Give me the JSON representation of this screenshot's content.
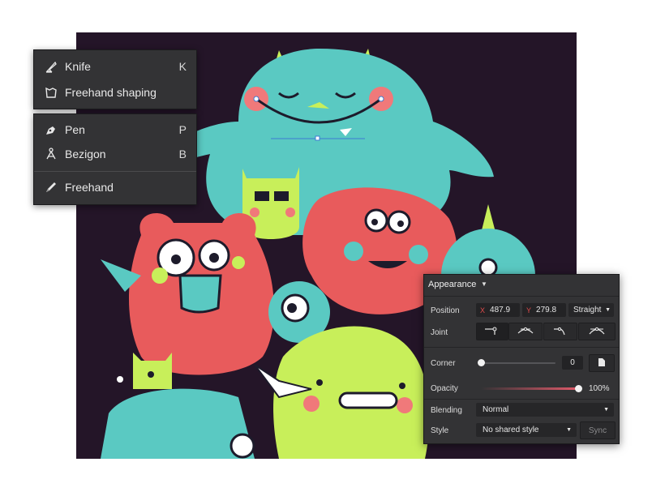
{
  "tools_top": [
    {
      "label": "Knife",
      "shortcut": "K",
      "icon": "knife-icon"
    },
    {
      "label": "Freehand shaping",
      "shortcut": "",
      "icon": "freehand-shaping-icon"
    }
  ],
  "tools_bottom": [
    {
      "label": "Pen",
      "shortcut": "P",
      "icon": "pen-icon"
    },
    {
      "label": "Bezigon",
      "shortcut": "B",
      "icon": "bezigon-icon"
    },
    {
      "label": "Freehand",
      "shortcut": "",
      "icon": "freehand-icon"
    }
  ],
  "appearance": {
    "title": "Appearance",
    "position_label": "Position",
    "x_axis": "X",
    "x_value": "487.9",
    "y_axis": "Y",
    "y_value": "279.8",
    "point_type": "Straight",
    "joint_label": "Joint",
    "corner_label": "Corner",
    "corner_value": "0",
    "opacity_label": "Opacity",
    "opacity_value": "100%",
    "opacity_fraction": 1.0,
    "corner_fraction": 0.0,
    "blending_label": "Blending",
    "blending_value": "Normal",
    "style_label": "Style",
    "style_value": "No shared style",
    "sync_label": "Sync"
  },
  "colors": {
    "canvas_bg": "#241528",
    "panel_bg": "#333335",
    "teal_monster": "#5ac9c2",
    "red_monster": "#e85b5c",
    "lime_monster": "#c8ef5a",
    "accent_red": "#e14b4b"
  }
}
